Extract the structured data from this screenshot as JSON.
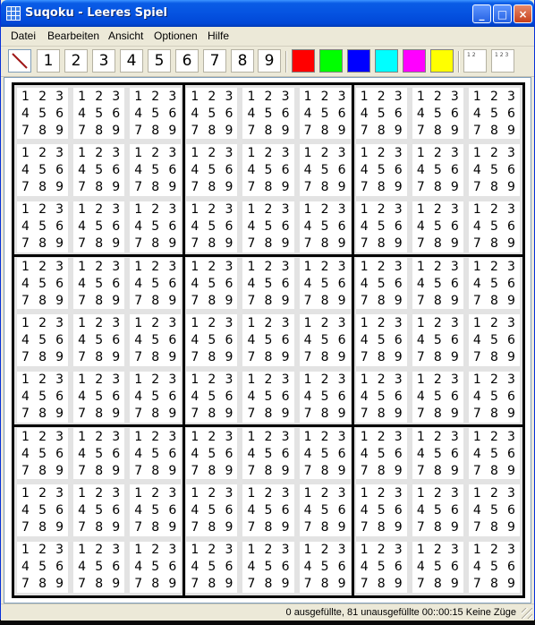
{
  "window": {
    "title": "Suqoku - Leeres Spiel"
  },
  "titlebar_buttons": {
    "minimize": "_",
    "maximize": "□",
    "close": "×"
  },
  "menu": [
    {
      "label": "Datei"
    },
    {
      "label": "Bearbeiten"
    },
    {
      "label": "Ansicht"
    },
    {
      "label": "Optionen"
    },
    {
      "label": "Hilfe"
    }
  ],
  "toolbar": {
    "eraser_icon": "eraser-slash-icon",
    "digits": [
      "1",
      "2",
      "3",
      "4",
      "5",
      "6",
      "7",
      "8",
      "9"
    ],
    "colors": [
      "#ff0000",
      "#00ff00",
      "#0000ff",
      "#00ffff",
      "#ff00ff",
      "#ffff00"
    ],
    "mode_small": "1 2",
    "mode_large": "1 2 3"
  },
  "board": {
    "size": 9,
    "candidates": [
      "1",
      "2",
      "3",
      "4",
      "5",
      "6",
      "7",
      "8",
      "9"
    ]
  },
  "status": {
    "text": "0 ausgefüllte, 81 unausgefüllte  00::00:15  Keine Züge"
  }
}
